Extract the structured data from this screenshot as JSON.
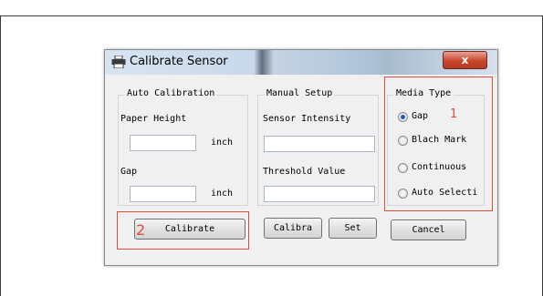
{
  "dialog": {
    "title": "Calibrate Sensor",
    "close_label": "x"
  },
  "auto_calibration": {
    "group_label": "Auto Calibration",
    "paper_height_label": "Paper Height",
    "paper_height_value": "",
    "paper_height_unit": "inch",
    "gap_label": "Gap",
    "gap_value": "",
    "gap_unit": "inch",
    "calibrate_button": "Calibrate"
  },
  "manual_setup": {
    "group_label": "Manual Setup",
    "sensor_intensity_label": "Sensor Intensity",
    "sensor_intensity_value": "",
    "threshold_label": "Threshold Value",
    "threshold_value": "",
    "calibrate_button": "Calibra",
    "set_button": "Set"
  },
  "media_type": {
    "group_label": "Media Type",
    "options": [
      {
        "label": "Gap",
        "checked": true
      },
      {
        "label": "Blach Mark",
        "checked": false
      },
      {
        "label": "Continuous",
        "checked": false
      },
      {
        "label": "Auto Selecti",
        "checked": false
      }
    ],
    "cancel_button": "Cancel"
  },
  "annotations": {
    "marker_1": "1",
    "marker_2": "2",
    "color": "#e14b3b"
  },
  "icons": {
    "title_icon": "printer-icon"
  }
}
